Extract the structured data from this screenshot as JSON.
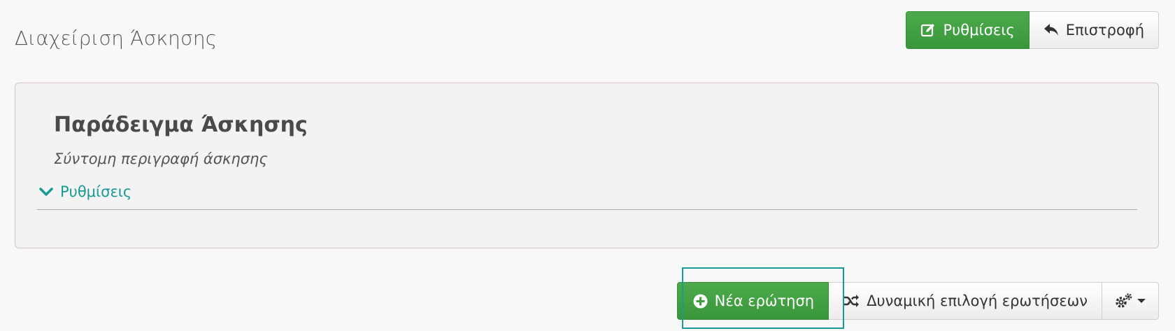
{
  "header": {
    "title": "Διαχείριση Άσκησης",
    "settings_button": "Ρυθμίσεις",
    "back_button": "Επιστροφή"
  },
  "panel": {
    "title": "Παράδειγμα Άσκησης",
    "description": "Σύντομη περιγραφή άσκησης",
    "settings_toggle": "Ρυθμίσεις"
  },
  "actions": {
    "new_question": "Νέα ερώτηση",
    "random_selection": "Δυναμική επιλογή ερωτήσεων"
  },
  "icons": {
    "settings": "edit-icon",
    "back": "reply-icon",
    "toggle": "chevron-down-icon",
    "new_question": "plus-circle-icon",
    "random": "shuffle-icon",
    "gear": "gears-icon",
    "caret": "caret-down-icon"
  },
  "colors": {
    "primary_green": "#3f9f3f",
    "accent_teal": "#1a9a94",
    "background": "#f8f8f8"
  }
}
